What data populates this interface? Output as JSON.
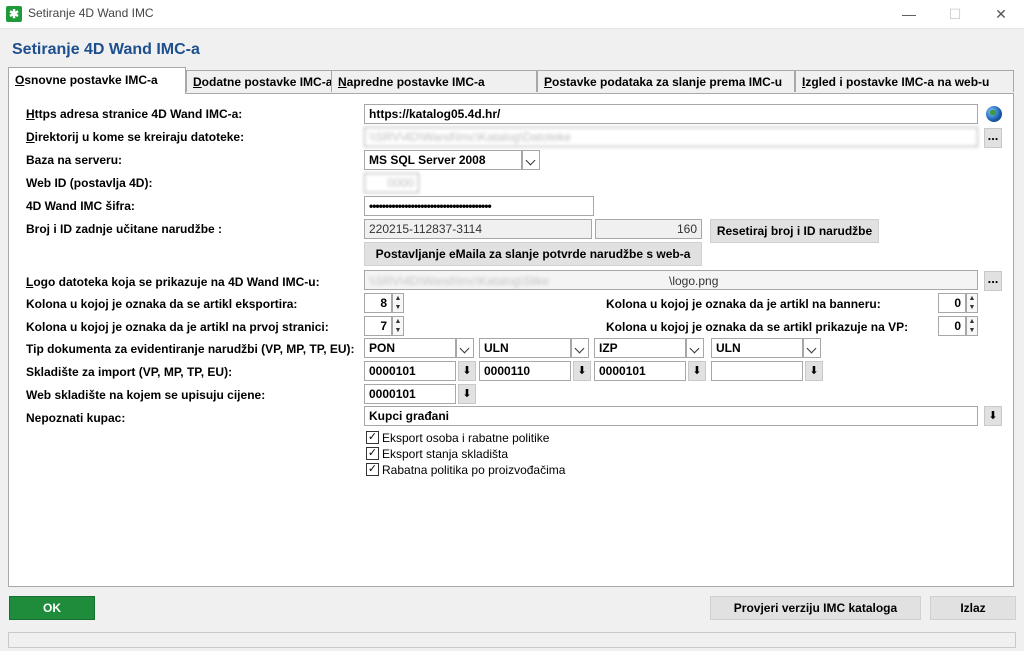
{
  "window": {
    "title": "Setiranje 4D Wand IMC",
    "icon_glyph": "✱"
  },
  "header": {
    "title": "Setiranje 4D Wand IMC-a"
  },
  "tabs": [
    {
      "label_u": "O",
      "label_rest": "snovne postavke IMC-a",
      "active": true
    },
    {
      "label_u": "D",
      "label_rest": "odatne postavke IMC-a",
      "active": false
    },
    {
      "label_u": "N",
      "label_rest": "apredne postavke IMC-a",
      "active": false
    },
    {
      "label_u": "P",
      "label_rest": "ostavke podataka za slanje prema IMC-u",
      "active": false
    },
    {
      "label_u": "I",
      "label_rest": "zgled i postavke IMC-a na web-u",
      "active": false
    }
  ],
  "form": {
    "https_label_u": "H",
    "https_label_rest": "ttps adresa stranice 4D Wand IMC-a:",
    "https_value": "https://katalog05.4d.hr/",
    "dir_label_u": "D",
    "dir_label_rest": "irektorij u kome se kreiraju datoteke:",
    "dir_value": "\\\\SRV\\4D\\Wand\\Imc\\Katalog\\Datoteke",
    "baza_label": "Baza na serveru:",
    "baza_value": "MS SQL Server 2008",
    "webid_label": "Web ID (postavlja 4D):",
    "webid_value": "0000",
    "sifra_label": "4D Wand IMC šifra:",
    "sifra_value": "••••••••••••••••••••••••••••••••••••••",
    "broj_label": "Broj i ID zadnje učitane narudžbe :",
    "broj_value": "220215-112837-3114",
    "id_value": "160",
    "reset_button": "Resetiraj broj i ID narudžbe",
    "email_button": "Postavljanje eMaila za slanje potvrde narudžbe s web-a",
    "logo_label_u": "L",
    "logo_label_rest": "ogo datoteka koja se prikazuje na 4D Wand IMC-u:",
    "logo_value_blur": "\\\\SRV\\4D\\Wand\\Imc\\Katalog\\Slike",
    "logo_value_file": "\\logo.png",
    "kol_export_label": "Kolona u kojoj je oznaka da se artikl eksportira:",
    "kol_export_value": "8",
    "kol_prva_label": "Kolona u kojoj je oznaka da je artikl na prvoj stranici:",
    "kol_prva_value": "7",
    "kol_banner_label": "Kolona u kojoj je oznaka da je artikl na banneru:",
    "kol_banner_value": "0",
    "kol_vp_label": "Kolona u kojoj je oznaka da se artikl prikazuje na VP:",
    "kol_vp_value": "0",
    "tip_label": "Tip dokumenta za evidentiranje narudžbi (VP, MP, TP, EU):",
    "tip_values": [
      "PON",
      "ULN",
      "IZP",
      "ULN"
    ],
    "sklad_label": "Skladište za import (VP, MP, TP, EU):",
    "sklad_values": [
      "0000101",
      "0000110",
      "0000101",
      ""
    ],
    "websklad_label": "Web skladište na kojem se upisuju cijene:",
    "websklad_value": "0000101",
    "kupac_label": "Nepoznati kupac:",
    "kupac_value": "Kupci građani",
    "checkboxes": [
      {
        "label": "Eksport osoba i rabatne politike",
        "checked": true
      },
      {
        "label": "Eksport stanja skladišta",
        "checked": true
      },
      {
        "label": "Rabatna politika po proizvođačima",
        "checked": true
      }
    ]
  },
  "footer": {
    "ok_button": "OK",
    "check_button": "Provjeri verziju IMC kataloga",
    "exit_button": "Izlaz"
  },
  "colors": {
    "accent": "#1d4f8f",
    "ok_green": "#1e8c3a"
  }
}
